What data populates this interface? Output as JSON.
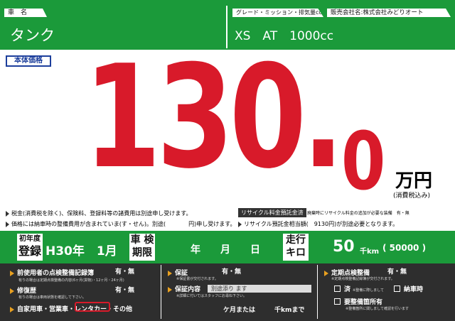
{
  "header": {
    "name_label": "車　名",
    "car_name": "タンク",
    "grade_label": "グレード・ミッション・排気量cc",
    "dealer_label": "販売会社名:株式会社みどりオート",
    "spec": "XS　AT　1000cc"
  },
  "price": {
    "label": "本体価格",
    "integer": "130.",
    "decimal": "0",
    "unit": "万円",
    "tax_note": "(消費税込み)"
  },
  "notes": {
    "line1": "税金(消費税を除く)、保険料、登録料等の諸費用は別途申し受けます。",
    "line2": "価格には納車時の整備費用が含まれていま(す・せん)。別途(　　　　円)申し受けます。",
    "recycle_label": "リサイクル料金預託金済",
    "recycle_note1": "廃棄時にリサイクル料金の追加が必要な装備　有・無",
    "recycle_note2": "リサイクル預託金相当額(　9130円)が別途必要となります。",
    "recycle_amount": "9130円"
  },
  "registration": {
    "first_reg_label_top": "初年度",
    "first_reg_label_bottom": "登録",
    "first_reg_value": "H30年　1月",
    "inspection_label_top": "車 検",
    "inspection_label_bottom": "期限",
    "inspection_value": "年　　月　　日",
    "mileage_label_top": "走行",
    "mileage_label_bottom": "キロ",
    "mileage_value": "50",
    "mileage_unit": "千km",
    "mileage_exact": "( 50000 )"
  },
  "bottom": {
    "col1": {
      "item1": "前使用者の点検整備記録簿",
      "item1_choice": "有・無",
      "item1_note": "有りの場合は定期点検整備の内容(6ヶ月(貨物)・12ヶ月・24ヶ月)",
      "item2": "修復歴",
      "item2_choice": "有・無",
      "item2_note": "有りの場合は車両状態を確認して下さい。",
      "item3": "自家用車・営業車・レンタカー・その他",
      "item3_selected": "レンタカー"
    },
    "col2": {
      "item1": "保証",
      "item1_choice": "有・無",
      "item1_note": "※保証書が交付されます。",
      "item2": "保証内容",
      "item2_value": "別途添り ます",
      "item2_note": "※詳細に付いてはスタッフにお尋ね下さい。",
      "item3": "ケ月または　　　千kmまで"
    },
    "col3": {
      "item1": "定期点検整備",
      "item1_choice": "有・無",
      "item1_note": "※定期点検整備記録簿が交付されます。",
      "check1": "済",
      "check1_note": "※整備に際しまして",
      "check2": "納車時",
      "check3": "要整備箇所有",
      "check3_note": "※整備箇所に関しまして確認を行います"
    }
  }
}
